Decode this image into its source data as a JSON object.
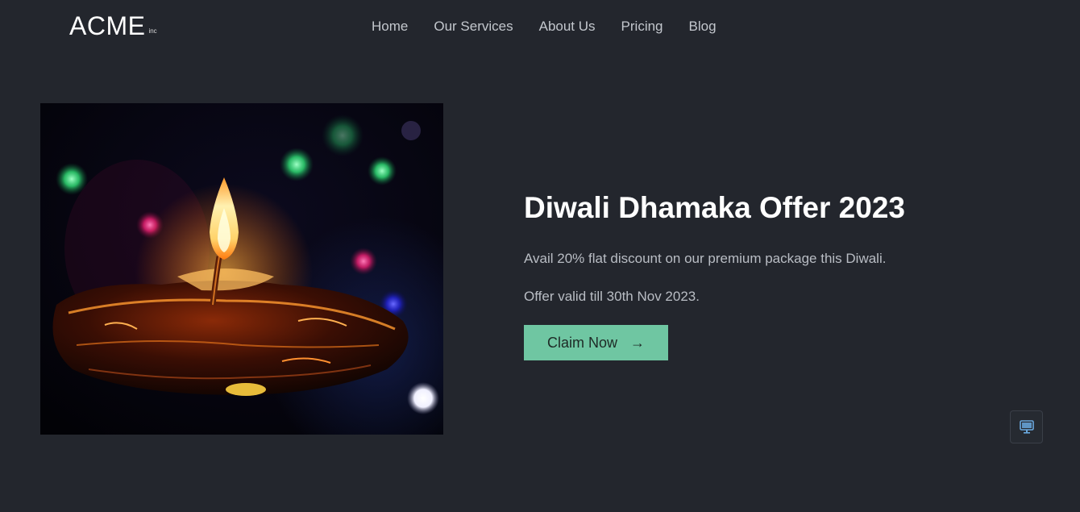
{
  "brand": {
    "name": "ACME",
    "suffix": "inc"
  },
  "nav": {
    "items": [
      {
        "label": "Home"
      },
      {
        "label": "Our Services"
      },
      {
        "label": "About Us"
      },
      {
        "label": "Pricing"
      },
      {
        "label": "Blog"
      }
    ]
  },
  "hero": {
    "title": "Diwali Dhamaka Offer 2023",
    "description": "Avail 20% flat discount on our premium package this Diwali.",
    "validity": "Offer valid till 30th Nov 2023.",
    "cta_label": "Claim Now",
    "cta_icon": "arrow-right-icon",
    "image_icon": "diya-lamp-photo"
  },
  "widget": {
    "icon": "monitor-icon"
  },
  "colors": {
    "background": "#23262d",
    "accent": "#6fc6a2",
    "nav_text": "#c3c7cd",
    "heading": "#ffffff",
    "widget_icon": "#6aa8de"
  }
}
